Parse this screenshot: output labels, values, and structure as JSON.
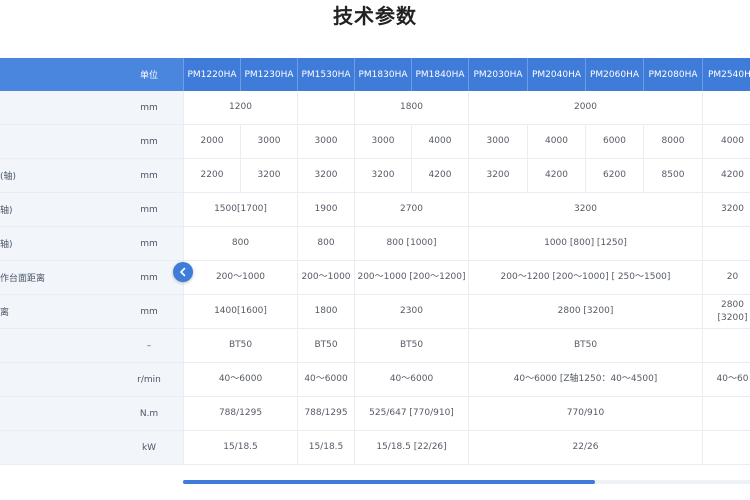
{
  "title": "技术参数",
  "header": {
    "unit_label": "单位",
    "models": [
      "PM1220HA",
      "PM1230HA",
      "PM1530HA",
      "PM1830HA",
      "PM1840HA",
      "PM2030HA",
      "PM2040HA",
      "PM2060HA",
      "PM2080HA",
      "PM2540HA"
    ]
  },
  "rows": [
    {
      "param": "",
      "unit": "mm",
      "cells": [
        "1200",
        "",
        "1800",
        "2000",
        ""
      ]
    },
    {
      "param": "",
      "unit": "mm",
      "cells": [
        "2000",
        "3000",
        "3000",
        "3000",
        "4000",
        "3000",
        "4000",
        "6000",
        "8000",
        "4000"
      ]
    },
    {
      "param": "(轴)",
      "unit": "mm",
      "cells": [
        "2200",
        "3200",
        "3200",
        "3200",
        "4200",
        "3200",
        "4200",
        "6200",
        "8500",
        "4200"
      ]
    },
    {
      "param": "轴)",
      "unit": "mm",
      "cells": [
        "1500[1700]",
        "1900",
        "2700",
        "3200",
        "3200"
      ]
    },
    {
      "param": "轴)",
      "unit": "mm",
      "cells": [
        "800",
        "800",
        "800 [1000]",
        "1000  [800] [1250]",
        ""
      ]
    },
    {
      "param": "作台面距离",
      "unit": "mm",
      "cells": [
        "200～1000",
        "200～1000",
        "200～1000 [200～1200]",
        "200～1200  [200～1000] [ 250～1500]",
        "20"
      ]
    },
    {
      "param": "离",
      "unit": "mm",
      "cells": [
        "1400[1600]",
        "1800",
        "2300",
        "2800  [3200]",
        "2800\n[3200]"
      ]
    },
    {
      "param": "",
      "unit": "–",
      "cells": [
        "BT50",
        "BT50",
        "BT50",
        "BT50",
        ""
      ]
    },
    {
      "param": "",
      "unit": "r/min",
      "cells": [
        "40～6000",
        "40～6000",
        "40～6000",
        "40～6000  [Z轴1250：40～4500]",
        "40～60"
      ]
    },
    {
      "param": "",
      "unit": "N.m",
      "cells": [
        "788/1295",
        "788/1295",
        "525/647 [770/910]",
        "770/910",
        ""
      ]
    },
    {
      "param": "",
      "unit": "kW",
      "cells": [
        "15/18.5",
        "15/18.5",
        "15/18.5 [22/26]",
        "22/26",
        ""
      ]
    }
  ],
  "controls": {
    "collapse_icon": "chevron-left-icon"
  },
  "scroll": {
    "position_fraction": 0.0,
    "visible_fraction": 0.73
  }
}
